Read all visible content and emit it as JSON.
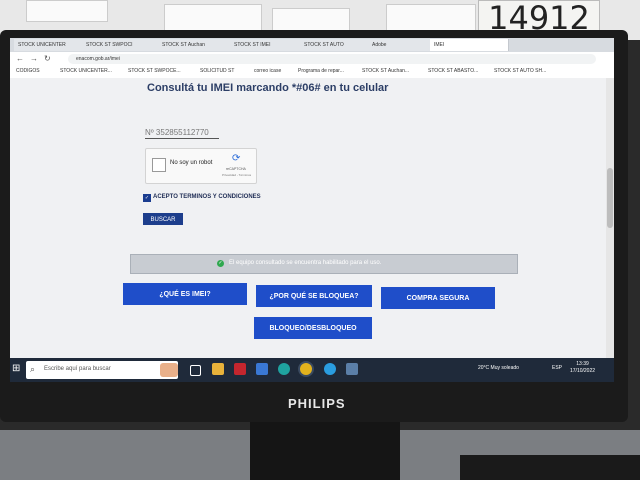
{
  "environment": {
    "monitor_brand": "PHILIPS",
    "note_text": "14912"
  },
  "browser": {
    "tabs": [
      {
        "label": "STOCK UNICENTER"
      },
      {
        "label": "STOCK ST SWPOCI"
      },
      {
        "label": "STOCK ST Auchan"
      },
      {
        "label": "STOCK ST IMEI"
      },
      {
        "label": "STOCK ST AUTO"
      },
      {
        "label": "Adobe"
      },
      {
        "label": "IMEI"
      }
    ],
    "url": "enacom.gob.ar/imei",
    "bookmarks": [
      {
        "label": "CODIGOS"
      },
      {
        "label": "STOCK UNICENTER..."
      },
      {
        "label": "STOCK ST SWPOCE..."
      },
      {
        "label": "SOLICITUD ST"
      },
      {
        "label": "correo icase"
      },
      {
        "label": "Programa de repar..."
      },
      {
        "label": "STOCK ST Auchan..."
      },
      {
        "label": "STOCK ST ABASTO..."
      },
      {
        "label": "STOCK ST AUTO SH..."
      }
    ]
  },
  "page": {
    "heading": "Consultá tu IMEI marcando *#06# en tu celular",
    "imei_value": "Nº 352855112770",
    "captcha": {
      "label": "No soy un robot",
      "brand": "reCAPTCHA",
      "links": "Privacidad - Términos"
    },
    "terms_label": "ACEPTO TERMINOS Y CONDICIONES",
    "search_button": "BUSCAR",
    "result_message": "El equipo consultado se encuentra habilitado para el uso.",
    "buttons": {
      "what_is_imei": "¿QUÉ ES IMEI?",
      "why_blocked": "¿POR QUÉ SE BLOQUEA?",
      "safe_purchase": "COMPRA SEGURA",
      "block_unblock": "BLOQUEO/DESBLOQUEO"
    }
  },
  "taskbar": {
    "search_placeholder": "Escribe aquí para buscar",
    "weather": "20°C  Muy soleado",
    "language": "ESP",
    "time": "13:39",
    "date": "17/10/2022"
  },
  "colors": {
    "primary_button": "#1f4ec9",
    "heading": "#2c3e66",
    "result_bg": "#c8ccd2",
    "success": "#2fa84f"
  }
}
